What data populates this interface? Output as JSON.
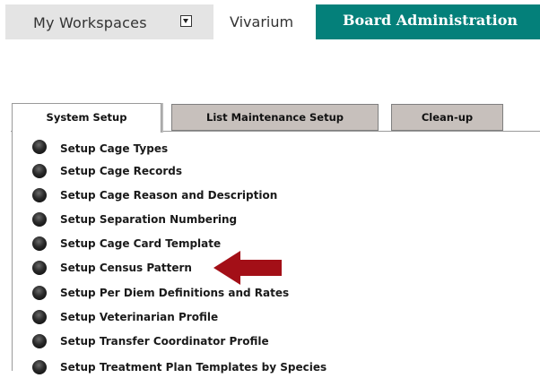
{
  "topnav": {
    "workspaces_label": "My Workspaces",
    "vivarium_label": "Vivarium",
    "board_label": "Board Administration",
    "accent_color": "#04807a"
  },
  "tabs": [
    {
      "label": "System Setup",
      "active": true
    },
    {
      "label": "List Maintenance Setup",
      "active": false
    },
    {
      "label": "Clean-up",
      "active": false
    }
  ],
  "menu": {
    "items": [
      {
        "label": "Setup Cage Types"
      },
      {
        "label": "Setup Cage Records"
      },
      {
        "label": "Setup Cage Reason and Description"
      },
      {
        "label": "Setup Separation Numbering"
      },
      {
        "label": "Setup Cage Card Template"
      },
      {
        "label": "Setup Census Pattern",
        "highlighted": true
      },
      {
        "label": "Setup Per Diem Definitions and Rates"
      },
      {
        "label": "Setup Veterinarian Profile"
      },
      {
        "label": "Setup Transfer Coordinator Profile"
      },
      {
        "label": "Setup Treatment Plan Templates by Species"
      }
    ]
  },
  "annotation": {
    "icon": "red-arrow-left-icon",
    "color": "#a30f17"
  }
}
